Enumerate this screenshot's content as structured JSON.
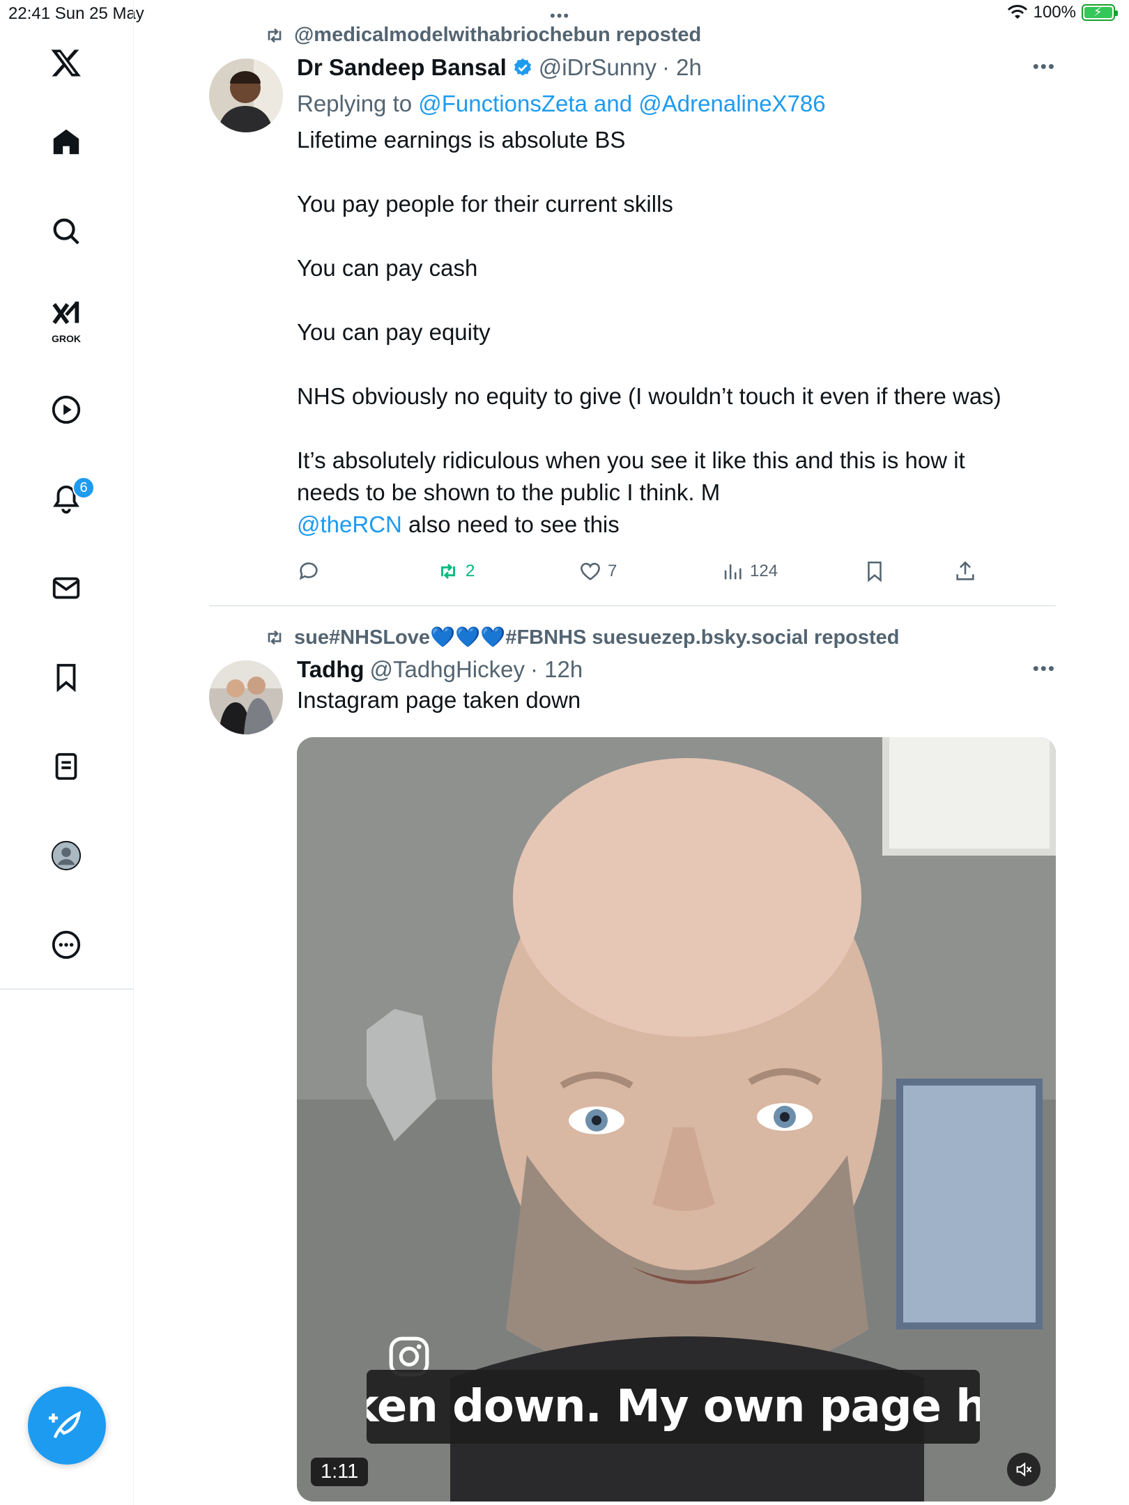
{
  "status_bar": {
    "time": "22:41  Sun 25 May",
    "dots": "•••",
    "battery_percent": "100%",
    "battery_level": 1.0
  },
  "sidebar": {
    "items": [
      {
        "icon": "x-logo-icon"
      },
      {
        "icon": "home-icon"
      },
      {
        "icon": "search-icon"
      },
      {
        "icon": "grok-icon",
        "label": "GROK"
      },
      {
        "icon": "video-play-icon"
      },
      {
        "icon": "notifications-bell-icon",
        "badge": "6"
      },
      {
        "icon": "messages-envelope-icon"
      },
      {
        "icon": "bookmarks-icon"
      },
      {
        "icon": "lists-icon"
      },
      {
        "icon": "profile-avatar-icon"
      },
      {
        "icon": "more-circle-icon"
      }
    ],
    "compose_icon": "compose-feather-icon"
  },
  "posts": [
    {
      "repost_label": "@medicalmodelwithabriochebun reposted",
      "author_name": "Dr Sandeep Bansal",
      "author_handle": "@iDrSunny",
      "time": "· 2h",
      "verified": true,
      "replying_prefix": "Replying to ",
      "replying_to_1": "@FunctionsZeta",
      "replying_and": " and ",
      "replying_to_2": "@AdrenalineX786",
      "paragraphs": [
        "Lifetime earnings is absolute BS",
        "You pay people for their current skills",
        "You can pay cash",
        "You can pay equity",
        "NHS obviously no equity to give (I wouldn’t touch it even if there was)",
        "It’s absolutely ridiculous when you see it like this and this is how it needs to be shown to the public I think. M"
      ],
      "last_line_mention": "@theRCN",
      "last_line_rest": " also need to see this",
      "stats": {
        "replies": "",
        "reposts": "2",
        "likes": "7",
        "views": "124"
      }
    },
    {
      "repost_label": "sue#NHSLove💙💙💙#FBNHS suesuezep.bsky.social reposted",
      "author_name": "Tadhg",
      "author_handle": "@TadhgHickey",
      "time": "· 12h",
      "text": "Instagram page taken down",
      "video": {
        "duration": "1:11",
        "caption": "taken down. My own page had",
        "muted": true
      }
    }
  ],
  "colors": {
    "accent": "#1d9bf0",
    "repost_green": "#00ba7c",
    "secondary_text": "#536471"
  }
}
